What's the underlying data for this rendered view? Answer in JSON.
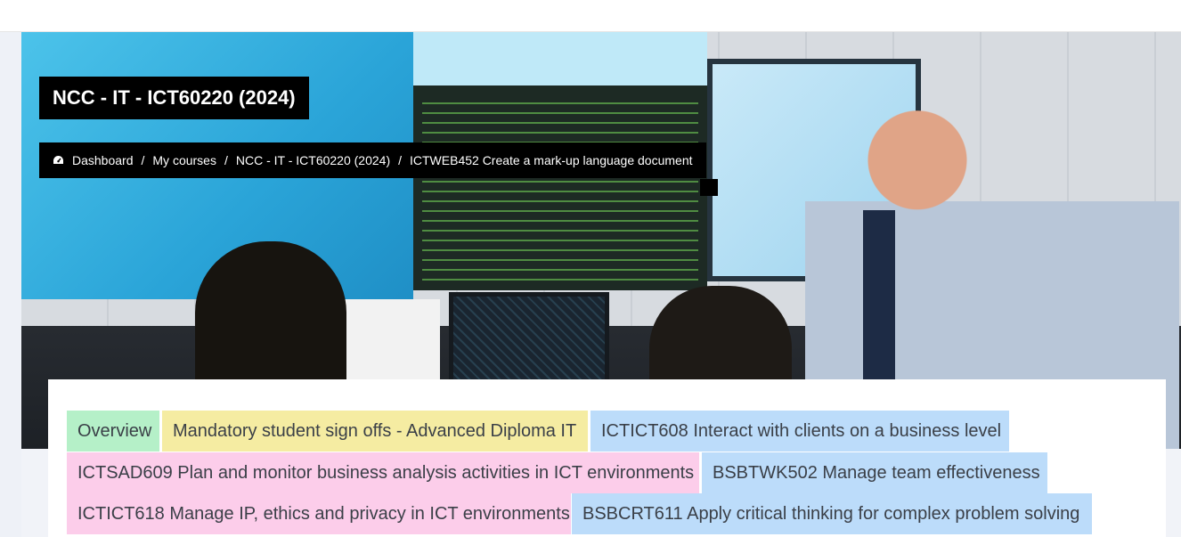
{
  "course_title": "NCC - IT - ICT60220 (2024)",
  "breadcrumb": {
    "icon": "dashboard-icon",
    "items": [
      "Dashboard",
      "My courses",
      "NCC - IT - ICT60220 (2024)",
      "ICTWEB452 Create a mark-up language document"
    ],
    "separator": "/"
  },
  "tabs": [
    {
      "label": "Overview",
      "color": "#b5f0c8"
    },
    {
      "label": "Mandatory student sign offs - Advanced Diploma IT",
      "color": "#f5eca2"
    },
    {
      "label": "ICTICT608 Interact with clients on a business level",
      "color": "#bcdcfa"
    },
    {
      "label": "ICTSAD609 Plan and monitor business analysis activities in ICT environments",
      "color": "#fccdea"
    },
    {
      "label": "BSBTWK502 Manage team effectiveness",
      "color": "#bcdcfa"
    },
    {
      "label": "ICTICT618 Manage IP, ethics and privacy in ICT environments",
      "color": "#fccdea"
    },
    {
      "label": "BSBCRT611 Apply critical thinking for complex problem solving",
      "color": "#bcdcfa"
    }
  ]
}
